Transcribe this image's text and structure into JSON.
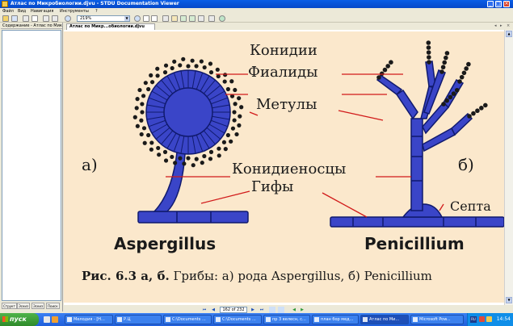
{
  "window": {
    "title": "Атлас по Микробиологии.djvu - STDU Documentation Viewer",
    "min": "_",
    "max": "□",
    "close": "×"
  },
  "menu": {
    "file": "Файл",
    "view": "Вид",
    "navigation": "Навигация",
    "tools": "Инструменты",
    "help": "?"
  },
  "toolbar": {
    "zoom": "219%"
  },
  "sidebar": {
    "header": "Содержание - Атлас по Микр",
    "tabs": [
      "Структ",
      "Эскиз",
      "Эскиз",
      "Поиск"
    ]
  },
  "doc_tab": {
    "title": "Атлас по Микр...обиологии.djvu",
    "prev": "◂",
    "next": "▸",
    "close": "×"
  },
  "figure": {
    "label_konidii": "Конидии",
    "label_fialidy": "Фиалиды",
    "label_metuly": "Метулы",
    "label_konidienostsy": "Конидиеносцы",
    "label_gify": "Гифы",
    "label_septa": "Септа",
    "label_a": "а)",
    "label_b": "б)",
    "name_aspergillus": "Aspergillus",
    "name_penicillium": "Penicillium",
    "caption_bold": "Рис. 6.3 а, б.",
    "caption_text": " Грибы: а) рода Aspergillus, б) Penicillium",
    "colors": {
      "fungus": "#3a45c8",
      "outline": "#101a6e",
      "leader": "#d11a1a",
      "page": "#fbe8cc"
    }
  },
  "navbar": {
    "page": "162 of 232",
    "first": "⏮",
    "prev": "◀",
    "next": "▶",
    "last": "⏭"
  },
  "taskbar": {
    "start": "пуск",
    "tasks": [
      "Мелодия - [Н...",
      "Р.Ц",
      "C:\\Documents ...",
      "C:\\Documents ...",
      "пр 3 велесн, с...",
      "план бор мед...",
      "Атлас по Ми...",
      "Microsoft Pow..."
    ],
    "lang": "RU",
    "clock": "14:54"
  }
}
